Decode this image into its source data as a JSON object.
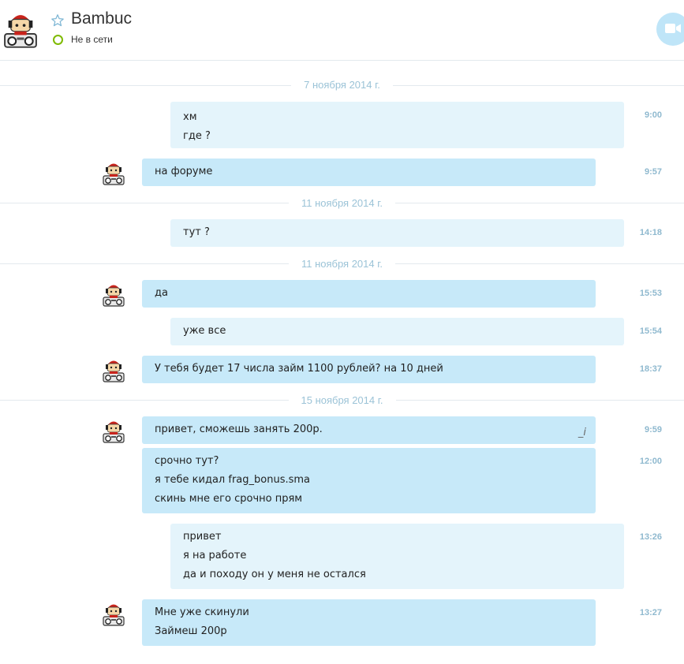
{
  "header": {
    "contact_name": "Bambuc",
    "status": "Не в сети",
    "favorite_icon": "star-outline-icon",
    "video_icon": "video-camera-icon"
  },
  "dates": [
    "7 ноября 2014 г.",
    "11 ноября 2014 г.",
    "11 ноября 2014 г.",
    "15 ноября 2014 г."
  ],
  "messages": [
    {
      "from": "me",
      "lines": [
        "хм",
        "где ?"
      ],
      "time": "9:00"
    },
    {
      "from": "contact",
      "lines": [
        "на форуме"
      ],
      "time": "9:57"
    },
    {
      "from": "me",
      "lines": [
        "тут ?"
      ],
      "time": "14:18"
    },
    {
      "from": "contact",
      "lines": [
        "да"
      ],
      "time": "15:53"
    },
    {
      "from": "me",
      "lines": [
        "уже все"
      ],
      "time": "15:54"
    },
    {
      "from": "contact",
      "lines": [
        "У тебя будет 17 числа займ 1100 рублей? на 10 дней"
      ],
      "time": "18:37"
    },
    {
      "from": "contact",
      "lines": [
        "привет, сможешь занять 200р."
      ],
      "time": "9:59",
      "edit_mark": "_i"
    },
    {
      "from": "contact",
      "lines": [
        "срочно тут?",
        "я тебе кидал frag_bonus.sma",
        "скинь мне его срочно прям"
      ],
      "time": "12:00"
    },
    {
      "from": "me",
      "lines": [
        "привет",
        "я на работе",
        "да и походу он у меня не остался"
      ],
      "time": "13:26"
    },
    {
      "from": "contact",
      "lines": [
        "Мне уже скинули",
        "Займеш 200р"
      ],
      "time": "13:27"
    }
  ],
  "colors": {
    "incoming_bubble": "#c7e9f9",
    "outgoing_bubble": "#e4f4fb",
    "timestamp": "#8fb9cf",
    "online_ring": "#7fba00",
    "video_button": "#bfe5f8"
  }
}
